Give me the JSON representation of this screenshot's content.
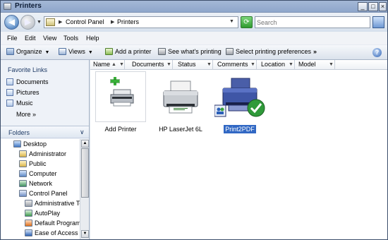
{
  "window": {
    "title": "Printers"
  },
  "nav": {
    "back_glyph": "◀",
    "forward_glyph": "▶"
  },
  "address": {
    "crumbs": [
      "Control Panel",
      "Printers"
    ]
  },
  "search": {
    "placeholder": "Search"
  },
  "menu": [
    "File",
    "Edit",
    "View",
    "Tools",
    "Help"
  ],
  "toolbar": {
    "organize": "Organize",
    "views": "Views",
    "add_printer": "Add a printer",
    "see_printing": "See what's printing",
    "select_prefs": "Select printing preferences",
    "more": "»"
  },
  "favorites": {
    "title": "Favorite Links",
    "items": [
      "Documents",
      "Pictures",
      "Music"
    ],
    "more": "More »"
  },
  "folders": {
    "title": "Folders",
    "tree": [
      {
        "label": "Desktop",
        "icon": "desktop-icon",
        "level": 0
      },
      {
        "label": "Administrator",
        "icon": "user-folder-icon",
        "level": 1
      },
      {
        "label": "Public",
        "icon": "folder-icon",
        "level": 1
      },
      {
        "label": "Computer",
        "icon": "computer-icon",
        "level": 1
      },
      {
        "label": "Network",
        "icon": "network-icon",
        "level": 1
      },
      {
        "label": "Control Panel",
        "icon": "control-panel-icon",
        "level": 1
      },
      {
        "label": "Administrative To",
        "icon": "admin-tools-icon",
        "level": 2
      },
      {
        "label": "AutoPlay",
        "icon": "autoplay-icon",
        "level": 2
      },
      {
        "label": "Default Programs",
        "icon": "default-programs-icon",
        "level": 2
      },
      {
        "label": "Ease of Access C",
        "icon": "ease-of-access-icon",
        "level": 2
      }
    ]
  },
  "columns": [
    "Name",
    "Documents",
    "Status",
    "Comments",
    "Location",
    "Model"
  ],
  "items": [
    {
      "label": "Add Printer",
      "icon": "add-printer-icon"
    },
    {
      "label": "HP LaserJet 6L",
      "icon": "printer-icon"
    },
    {
      "label": "Print2PDF",
      "icon": "default-printer-icon",
      "selected": true
    }
  ],
  "colors": {
    "selection": "#3168c4",
    "default_check": "#2f9a3a"
  }
}
